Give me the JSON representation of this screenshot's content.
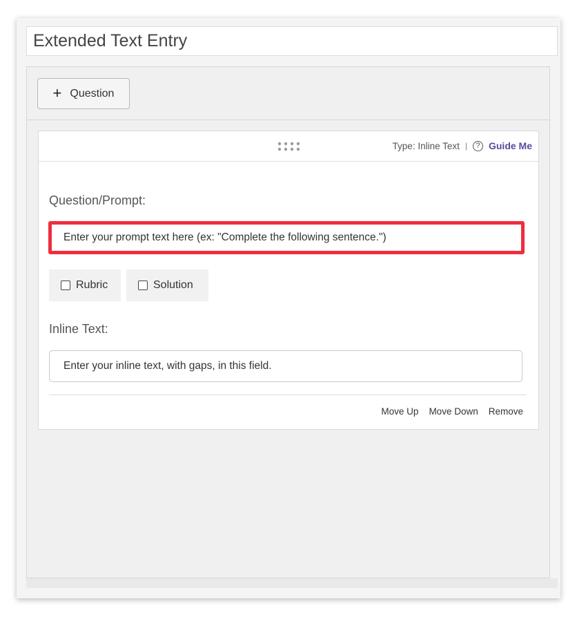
{
  "title": "Extended Text Entry",
  "toolbar": {
    "add_question_label": "Question"
  },
  "card": {
    "type_label": "Type: Inline Text",
    "separator": "|",
    "help_glyph": "?",
    "guide_label": "Guide Me",
    "prompt_label": "Question/Prompt:",
    "prompt_placeholder": "Enter your prompt text here (ex: \"Complete the following sentence.\")",
    "options": [
      {
        "label": "Rubric",
        "checked": false
      },
      {
        "label": "Solution",
        "checked": false
      }
    ],
    "inline_label": "Inline Text:",
    "inline_placeholder": "Enter your inline text, with gaps, in this field.",
    "actions": {
      "move_up": "Move Up",
      "move_down": "Move Down",
      "remove": "Remove"
    }
  },
  "colors": {
    "highlight": "#ee2e3d",
    "guide_link": "#5b4a9c"
  },
  "icons": {
    "add": "plus-icon",
    "drag": "drag-handle-icon",
    "help": "help-circle-icon"
  }
}
